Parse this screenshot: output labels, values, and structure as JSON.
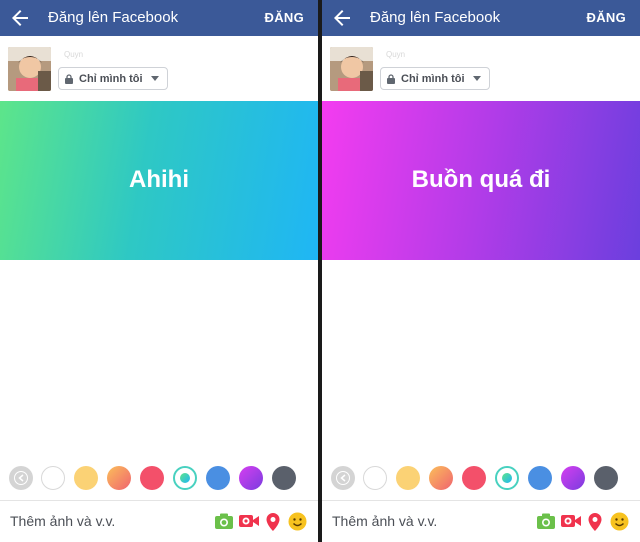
{
  "header": {
    "title": "Đăng lên Facebook",
    "post_label": "ĐĂNG"
  },
  "composer": {
    "username": "Quyn",
    "privacy_label": "Chỉ mình tôi"
  },
  "screens": [
    {
      "banner_text": "Ahihi",
      "gradient": [
        "#5de58a",
        "#1fb6f5"
      ]
    },
    {
      "banner_text": "Buồn quá đi",
      "gradient": [
        "#f43cf0",
        "#6b3fde"
      ]
    }
  ],
  "palette": {
    "colors": [
      "#ffffff",
      "#fbd275",
      "#f8a05b",
      "#f3506a",
      "#4bd6c2",
      "#4a8fe2",
      "#a93de9",
      "#5a606b"
    ],
    "selected_index": 4
  },
  "bottom_bar": {
    "add_label": "Thêm ảnh và v.v."
  },
  "colors": {
    "header": "#3b5998",
    "photo_icon": "#6bc04a",
    "video_icon": "#f0334d",
    "location_icon": "#f0334d",
    "feeling_icon": "#f7c21f"
  }
}
